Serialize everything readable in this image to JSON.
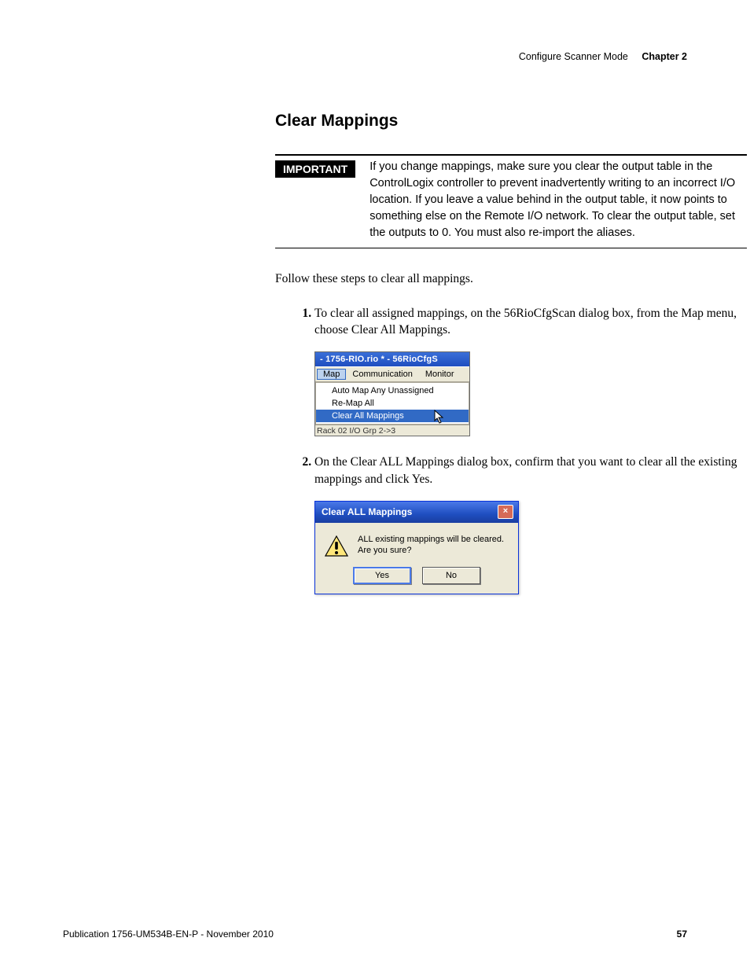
{
  "header": {
    "breadcrumb": "Configure Scanner Mode",
    "chapter": "Chapter 2"
  },
  "section_title": "Clear Mappings",
  "important": {
    "label": "IMPORTANT",
    "text": "If you change mappings, make sure you clear the output table in the ControlLogix controller to prevent inadvertently writing to an incorrect I/O location. If you leave a value behind in the output table, it now points to something else on the Remote I/O network. To clear the output table, set the outputs to 0. You must also re-import the aliases."
  },
  "intro": "Follow these steps to clear all mappings.",
  "steps": {
    "s1": "To clear all assigned mappings, on the 56RioCfgScan dialog box, from the Map menu, choose Clear All Mappings.",
    "s2": "On the Clear ALL Mappings dialog box, confirm that you want to clear all the existing mappings and click Yes."
  },
  "screenshot1": {
    "title": "- 1756-RIO.rio * - 56RioCfgS",
    "menu": {
      "map": "Map",
      "comm": "Communication",
      "mon": "Monitor"
    },
    "options": {
      "o1": "Auto Map Any Unassigned",
      "o2": "Re-Map All",
      "o3": "Clear All Mappings"
    },
    "below": "Rack 02 I/O Grp 2->3"
  },
  "screenshot2": {
    "title": "Clear ALL Mappings",
    "close": "×",
    "message_l1": "ALL existing mappings will be cleared.",
    "message_l2": "Are you sure?",
    "yes": "Yes",
    "no": "No"
  },
  "footer": {
    "pub": "Publication 1756-UM534B-EN-P - November 2010",
    "page": "57"
  }
}
